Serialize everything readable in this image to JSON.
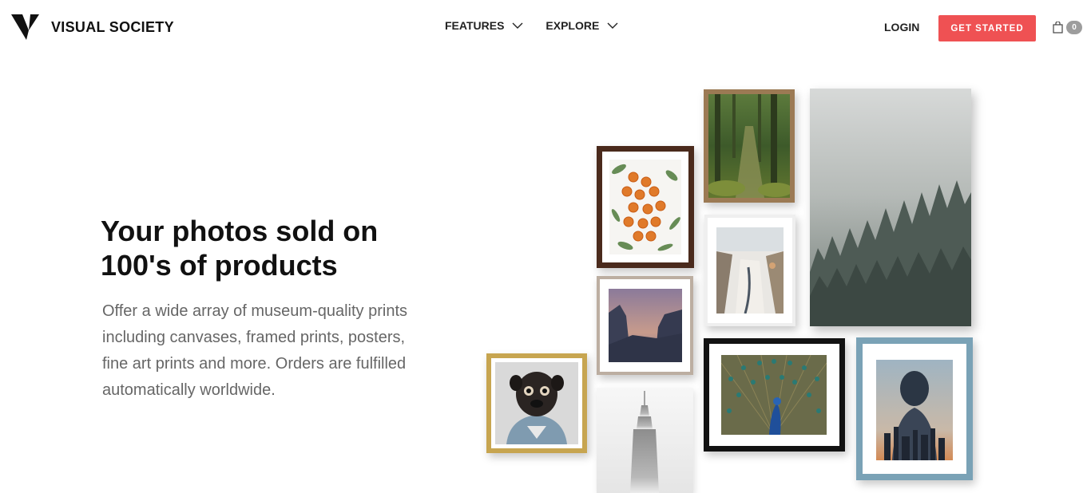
{
  "brand": {
    "name": "VISUAL SOCIETY",
    "logo_icon": "v-logo-icon"
  },
  "nav": {
    "items": [
      {
        "label": "FEATURES",
        "icon": "chevron-down-icon"
      },
      {
        "label": "EXPLORE",
        "icon": "chevron-down-icon"
      }
    ],
    "login_label": "LOGIN",
    "cta_label": "GET STARTED",
    "cart": {
      "icon": "shopping-bag-icon",
      "count": "0"
    }
  },
  "hero": {
    "title": "Your photos sold on 100's of products",
    "copy": "Offer a wide array of museum-quality prints including canvases, framed prints, posters, fine art prints and more. Orders are fulfilled automatically worldwide."
  },
  "colors": {
    "accent": "#ef5153",
    "text_dark": "#111111",
    "text_muted": "#666666",
    "badge": "#9d9d9d"
  },
  "gallery": [
    "dried-orange-slices-print",
    "forest-path-print",
    "misty-forest-canvas",
    "snowy-canyon-print",
    "mountain-valley-print",
    "peacock-print",
    "double-exposure-portrait-print",
    "pug-portrait-print",
    "empire-state-building-print"
  ]
}
